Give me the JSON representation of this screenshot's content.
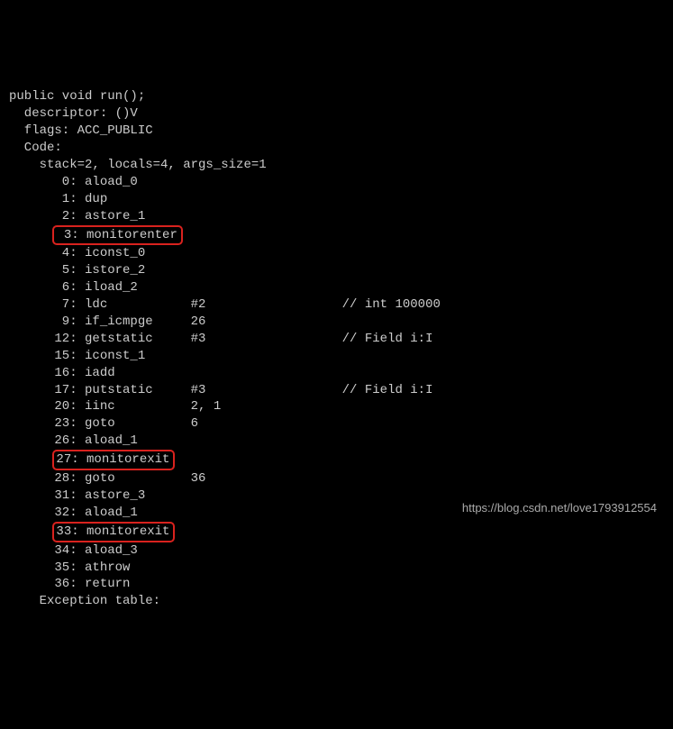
{
  "header": {
    "sig": "public void run();",
    "descriptor": "  descriptor: ()V",
    "flags": "  flags: ACC_PUBLIC",
    "code": "  Code:",
    "attrs": "    stack=2, locals=4, args_size=1"
  },
  "instr": {
    "l0": "       0: aload_0",
    "l1": "       1: dup",
    "l2": "       2: astore_1",
    "l3": " 3: monitorenter",
    "l4": "       4: iconst_0",
    "l5": "       5: istore_2",
    "l6": "       6: iload_2",
    "l7": "       7: ldc           #2                  // int 100000",
    "l9": "       9: if_icmpge     26",
    "l12": "      12: getstatic     #3                  // Field i:I",
    "l15": "      15: iconst_1",
    "l16": "      16: iadd",
    "l17": "      17: putstatic     #3                  // Field i:I",
    "l20": "      20: iinc          2, 1",
    "l23": "      23: goto          6",
    "l26": "      26: aload_1",
    "l27": "27: monitorexit",
    "l28": "      28: goto          36",
    "l31": "      31: astore_3",
    "l32": "      32: aload_1",
    "l33": "33: monitorexit",
    "l34": "      34: aload_3",
    "l35": "      35: athrow",
    "l36": "      36: return"
  },
  "pad": {
    "hl": "      "
  },
  "footer": {
    "exctable": "    Exception table:"
  },
  "watermark": "https://blog.csdn.net/love1793912554"
}
